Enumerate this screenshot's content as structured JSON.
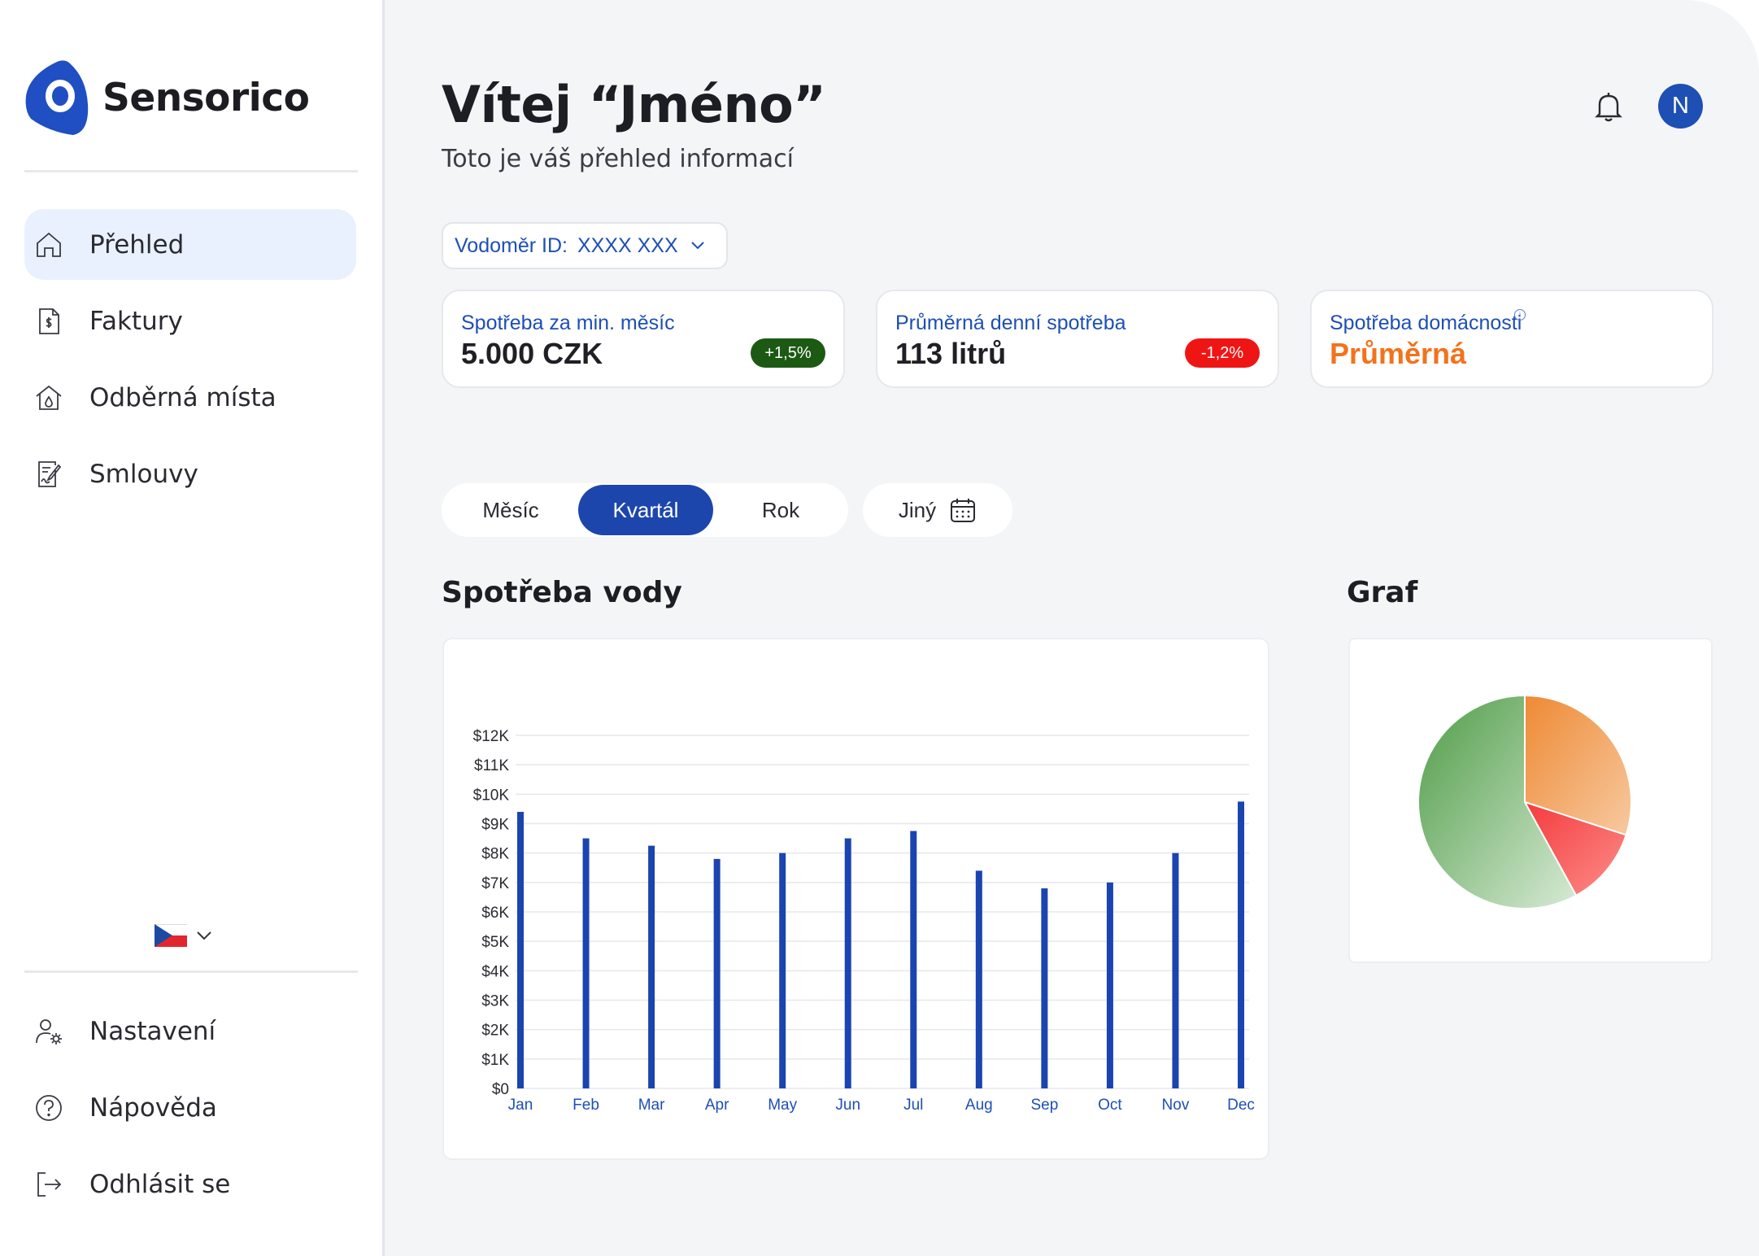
{
  "brand": {
    "name": "Sensorico",
    "color": "#1d4fb5"
  },
  "sidebar": {
    "nav": [
      {
        "label": "Přehled",
        "icon": "home-icon",
        "active": true
      },
      {
        "label": "Faktury",
        "icon": "invoice-icon",
        "active": false
      },
      {
        "label": "Odběrná místa",
        "icon": "house-drop-icon",
        "active": false
      },
      {
        "label": "Smlouvy",
        "icon": "contract-icon",
        "active": false
      }
    ],
    "language": {
      "flag": "czech-flag-icon"
    },
    "bottom": [
      {
        "label": "Nastavení",
        "icon": "user-settings-icon"
      },
      {
        "label": "Nápověda",
        "icon": "help-icon"
      },
      {
        "label": "Odhlásit se",
        "icon": "logout-icon"
      }
    ]
  },
  "header": {
    "greeting": "Vítej “Jméno”",
    "subtitle": "Toto je váš přehled informací",
    "avatar_initial": "N"
  },
  "meter": {
    "label": "Vodoměr ID:",
    "value": "XXXX XXX"
  },
  "cards": [
    {
      "label": "Spotřeba za min. měsíc",
      "value": "5.000 CZK",
      "badge": "+1,5%",
      "badge_color": "#1c5a14"
    },
    {
      "label": "Průměrná denní spotřeba",
      "value": "113 litrů",
      "badge": "-1,2%",
      "badge_color": "#f01515"
    },
    {
      "label": "Spotřeba domácnosti",
      "value": "Průměrná",
      "value_color": "#f2731c"
    }
  ],
  "period": {
    "options": [
      "Měsíc",
      "Kvartál",
      "Rok"
    ],
    "selected": "Kvartál",
    "other_label": "Jiný"
  },
  "sections": {
    "water": "Spotřeba vody",
    "graph": "Graf"
  },
  "chart_data": [
    {
      "type": "bar",
      "categories": [
        "Jan",
        "Feb",
        "Mar",
        "Apr",
        "May",
        "Jun",
        "Jul",
        "Aug",
        "Sep",
        "Oct",
        "Nov",
        "Dec"
      ],
      "values": [
        9400,
        8500,
        8250,
        7800,
        8000,
        8500,
        8750,
        7400,
        6800,
        7000,
        8000,
        9750
      ],
      "yticks": [
        "$0",
        "$1K",
        "$2K",
        "$3K",
        "$4K",
        "$5K",
        "$6K",
        "$7K",
        "$8K",
        "$9K",
        "$10K",
        "$11K",
        "$12K"
      ],
      "ylim": [
        0,
        12000
      ],
      "color": "#1a44b0",
      "grid": true
    },
    {
      "type": "pie",
      "values": [
        30,
        12,
        58
      ],
      "colors": [
        "#f08c3c",
        "#f5474a",
        "#5ea85a"
      ]
    }
  ]
}
